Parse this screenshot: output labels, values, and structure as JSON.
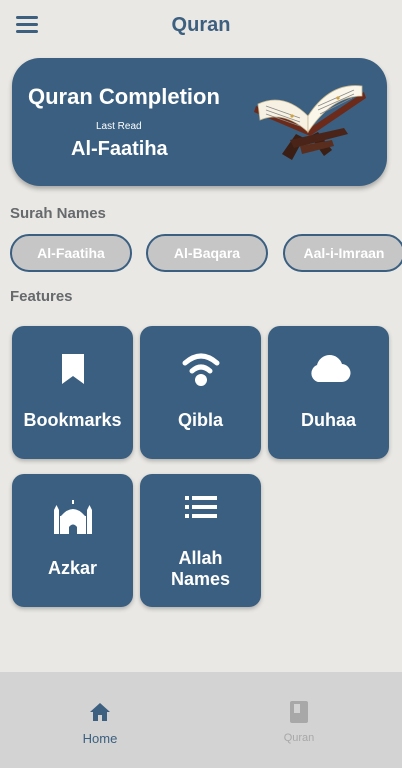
{
  "header": {
    "title": "Quran",
    "menu_icon": "menu-icon"
  },
  "hero": {
    "title": "Quran Completion",
    "last_read_label": "Last Read",
    "last_read_surah": "Al-Faatiha",
    "image": "open-quran-book-on-stand"
  },
  "surah_section": {
    "title": "Surah Names",
    "chips": [
      "Al-Faatiha",
      "Al-Baqara",
      "Aal-i-Imraan"
    ]
  },
  "features_section": {
    "title": "Features",
    "cards": [
      {
        "label": "Bookmarks",
        "icon": "bookmark-icon"
      },
      {
        "label": "Qibla",
        "icon": "wifi-icon"
      },
      {
        "label": "Duhaa",
        "icon": "cloud-icon"
      },
      {
        "label": "Azkar",
        "icon": "mosque-icon"
      },
      {
        "label": "Allah Names",
        "icon": "list-icon"
      }
    ]
  },
  "bottom_nav": {
    "items": [
      {
        "label": "Home",
        "icon": "home-icon",
        "active": true
      },
      {
        "label": "Quran",
        "icon": "book-icon",
        "active": false
      }
    ]
  },
  "colors": {
    "primary": "#3a5f80",
    "background": "#e9e8e4",
    "chip_fill": "#c6c6c6",
    "nav_background": "#d3d3d3",
    "nav_active": "#3d6080",
    "nav_inactive": "#a8a8a8"
  }
}
